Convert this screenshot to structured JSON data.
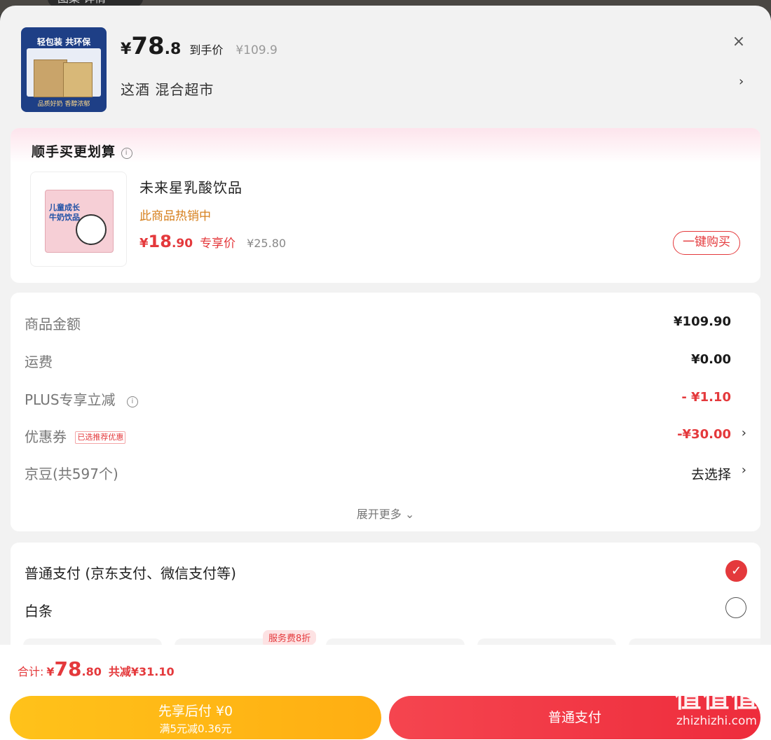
{
  "background": {
    "tab_label": "图集 详情"
  },
  "header": {
    "currency": "¥",
    "price_int": "78",
    "price_dec": ".8",
    "final_price_label": "到手价",
    "original_price": "¥109.9",
    "shop_name": "这酒  混合超市",
    "close_glyph": "×",
    "thumb_slogan": "轻包装 共环保",
    "thumb_tagline": "品质好奶 香醇浓郁"
  },
  "bundle": {
    "title": "顺手买更划算",
    "info_glyph": "i",
    "thumb_text": "儿童成长 牛奶饮品",
    "product_name": "未来星乳酸饮品",
    "hot_label": "此商品热销中",
    "currency": "¥",
    "price_int": "18",
    "price_dec": ".90",
    "price_label": "专享价",
    "original_price": "¥25.80",
    "buy_button": "一键购买"
  },
  "summary": {
    "rows": [
      {
        "label": "商品金额",
        "value": "¥109.90"
      },
      {
        "label": "运费",
        "value": "¥0.00"
      },
      {
        "label": "PLUS专享立减",
        "value": "- ¥1.10"
      },
      {
        "label": "优惠券",
        "badge": "已选推荐优惠",
        "value": "-¥30.00"
      },
      {
        "label": "京豆(共597个)",
        "value": "去选择"
      }
    ],
    "expand": "展开更多 ⌄"
  },
  "payment": {
    "normal_label": "普通支付 (京东支付、微信支付等)",
    "baitiao_label": "白条",
    "service_tag": "服务费8折",
    "check_glyph": "✓"
  },
  "bottom": {
    "total_label": "合计:",
    "currency": "¥",
    "total_int": "78",
    "total_dec": ".80",
    "saved": "共减¥31.10",
    "later_line1": "先享后付 ¥0",
    "later_line2": "满5元减0.36元",
    "pay_button": "普通支付"
  },
  "watermark": {
    "line1": "值值值",
    "line2": "zhizhizhi.com"
  },
  "colors": {
    "accent_red": "#e4393c",
    "hot_orange": "#d6801e",
    "later_yellow": "#ffb814"
  }
}
